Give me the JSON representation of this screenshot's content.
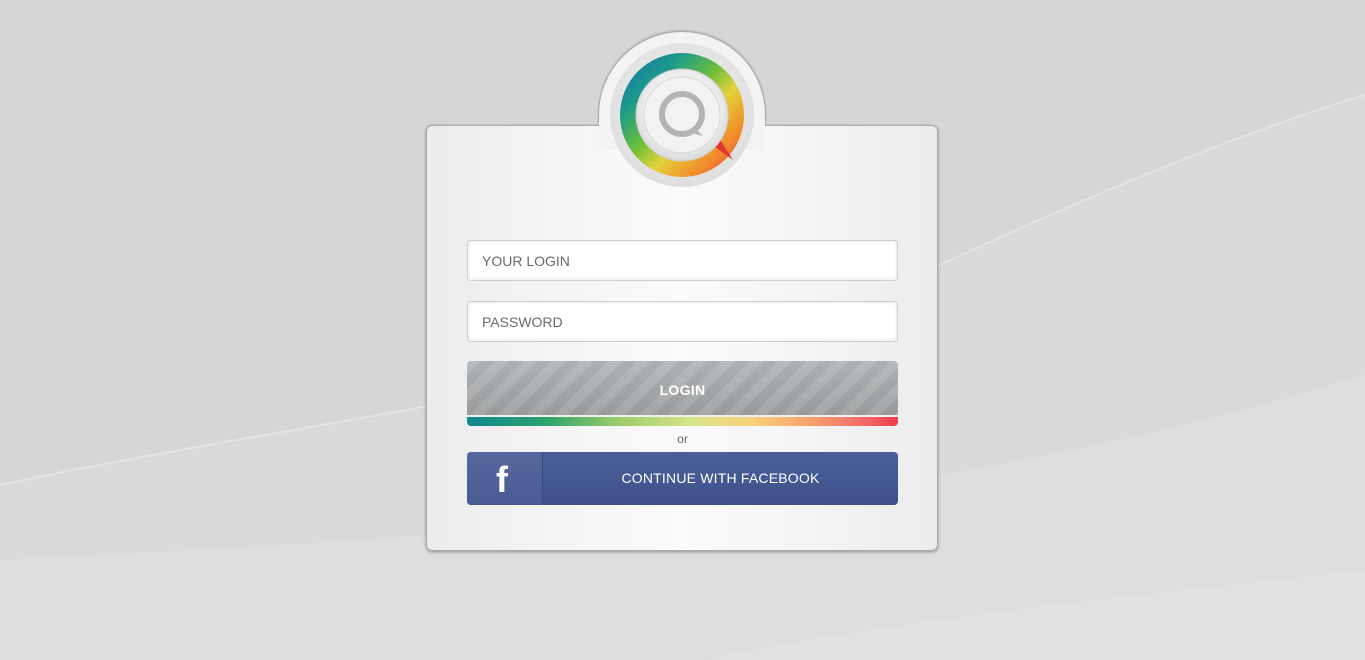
{
  "login_form": {
    "login_placeholder": "YOUR LOGIN",
    "password_placeholder": "PASSWORD",
    "login_button_label": "LOGIN",
    "separator_text": "or",
    "facebook_button_label": "CONTINUE WITH FACEBOOK",
    "facebook_icon_glyph": "f"
  },
  "logo": {
    "icon": "rainbow-q-logo",
    "ring_colors": [
      "#1a8a98",
      "#4caf50",
      "#cddc39",
      "#f4a12a",
      "#e63b2e"
    ]
  },
  "icons": {
    "facebook": "facebook-icon"
  },
  "colors": {
    "background": "#d6d6d6",
    "card": "#f4f4f4",
    "login_button": "#a8abad",
    "facebook_button": "#3e5189",
    "text_muted": "#666666"
  }
}
